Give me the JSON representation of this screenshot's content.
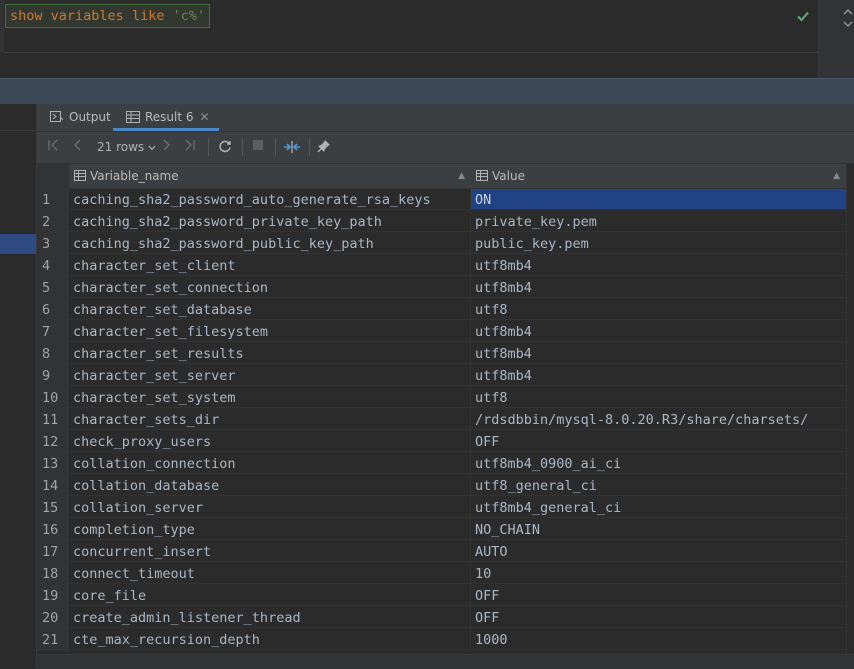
{
  "editor": {
    "query_keyword1": "show",
    "query_keyword2": "variables",
    "query_keyword3": "like",
    "query_string": "'c%'",
    "status_icon": "check-icon"
  },
  "tabs": [
    {
      "label": "Output",
      "icon": "output-icon"
    },
    {
      "label": "Result 6",
      "icon": "table-icon",
      "active": true
    }
  ],
  "toolbar": {
    "rows_label": "21 rows"
  },
  "grid": {
    "columns": [
      "Variable_name",
      "Value"
    ],
    "rows": [
      {
        "n": "1",
        "name": "caching_sha2_password_auto_generate_rsa_keys",
        "value": "ON"
      },
      {
        "n": "2",
        "name": "caching_sha2_password_private_key_path",
        "value": "private_key.pem"
      },
      {
        "n": "3",
        "name": "caching_sha2_password_public_key_path",
        "value": "public_key.pem"
      },
      {
        "n": "4",
        "name": "character_set_client",
        "value": "utf8mb4"
      },
      {
        "n": "5",
        "name": "character_set_connection",
        "value": "utf8mb4"
      },
      {
        "n": "6",
        "name": "character_set_database",
        "value": "utf8"
      },
      {
        "n": "7",
        "name": "character_set_filesystem",
        "value": "utf8mb4"
      },
      {
        "n": "8",
        "name": "character_set_results",
        "value": "utf8mb4"
      },
      {
        "n": "9",
        "name": "character_set_server",
        "value": "utf8mb4"
      },
      {
        "n": "10",
        "name": "character_set_system",
        "value": "utf8"
      },
      {
        "n": "11",
        "name": "character_sets_dir",
        "value": "/rdsdbbin/mysql-8.0.20.R3/share/charsets/"
      },
      {
        "n": "12",
        "name": "check_proxy_users",
        "value": "OFF"
      },
      {
        "n": "13",
        "name": "collation_connection",
        "value": "utf8mb4_0900_ai_ci"
      },
      {
        "n": "14",
        "name": "collation_database",
        "value": "utf8_general_ci"
      },
      {
        "n": "15",
        "name": "collation_server",
        "value": "utf8mb4_general_ci"
      },
      {
        "n": "16",
        "name": "completion_type",
        "value": "NO_CHAIN"
      },
      {
        "n": "17",
        "name": "concurrent_insert",
        "value": "AUTO"
      },
      {
        "n": "18",
        "name": "connect_timeout",
        "value": "10"
      },
      {
        "n": "19",
        "name": "core_file",
        "value": "OFF"
      },
      {
        "n": "20",
        "name": "create_admin_listener_thread",
        "value": "OFF"
      },
      {
        "n": "21",
        "name": "cte_max_recursion_depth",
        "value": "1000"
      }
    ]
  },
  "colors": {
    "selection": "#214283",
    "keyword": "#cc7832",
    "string": "#6a8759",
    "accent_tab": "#4a88c7"
  }
}
